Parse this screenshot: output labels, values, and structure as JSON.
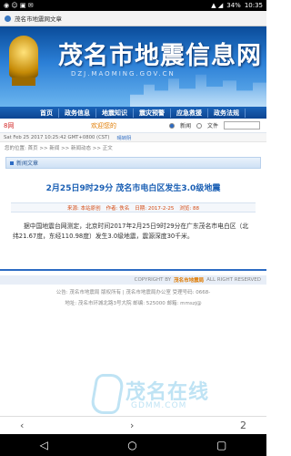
{
  "status_bar": {
    "left_icons": "◉ ☺ ▣ ✉",
    "signal": "▲ ◢",
    "battery": "34%",
    "time": "10:35"
  },
  "browser": {
    "tab_title": "茂名市地震网文章",
    "back_icon": "chevron-left-icon",
    "forward_icon": "chevron-right-icon",
    "tabs_count": "2"
  },
  "banner": {
    "title": "茂名市地震信息网",
    "subtitle": "DZJ.MAOMING.GOV.CN"
  },
  "nav": {
    "items": [
      "首页",
      "政务信息",
      "地震知识",
      "震灾预警",
      "应急救援",
      "政务法规"
    ]
  },
  "toolbar": {
    "home_link": "8网",
    "welcome": "欢迎您的",
    "search_option_1": "新闻",
    "search_option_2": "文件"
  },
  "datebar": {
    "date": "Sat Feb 25 2017 10:25:42 GMT+0800 (CST)",
    "weather": "晴转阴"
  },
  "breadcrumb": "您的位置: 首页 >> 新闻 >> 新闻动态 >> 正文",
  "section": {
    "label": "新闻文章"
  },
  "article": {
    "title": "2月25日9时29分 茂名市电白区发生3.0级地震",
    "meta_source": "来源: 本站原创",
    "meta_author": "作者: 佚名",
    "meta_date": "日期: 2017-2-25",
    "meta_views": "浏览: 88",
    "body": "据中国地震台网测定，北京时间2017年2月25日9时29分在广东茂名市电白区（北纬21.67度，东经110.98度）发生3.0级地震，震源深度30千米。"
  },
  "footer": {
    "copyright_prefix": "COPYRIGHT BY",
    "copyright_site": "茂名市地震局",
    "copyright_suffix": "ALL RIGHT RESERVED",
    "line1": "公告: 茂名市地震局 版权所有 | 茂名市地震局办公室 受理号码: 0668-",
    "line2": "地址: 茂名市环城北路3号大院 邮编: 525000 邮箱: mmszj@"
  },
  "watermark": {
    "main": "茂名在线",
    "sub": "GDMM.COM"
  },
  "colors": {
    "accent": "#2c6bc3",
    "banner_top": "#0a4c9a",
    "title_blue": "#1a5fb4",
    "meta_orange": "#d44a12"
  }
}
